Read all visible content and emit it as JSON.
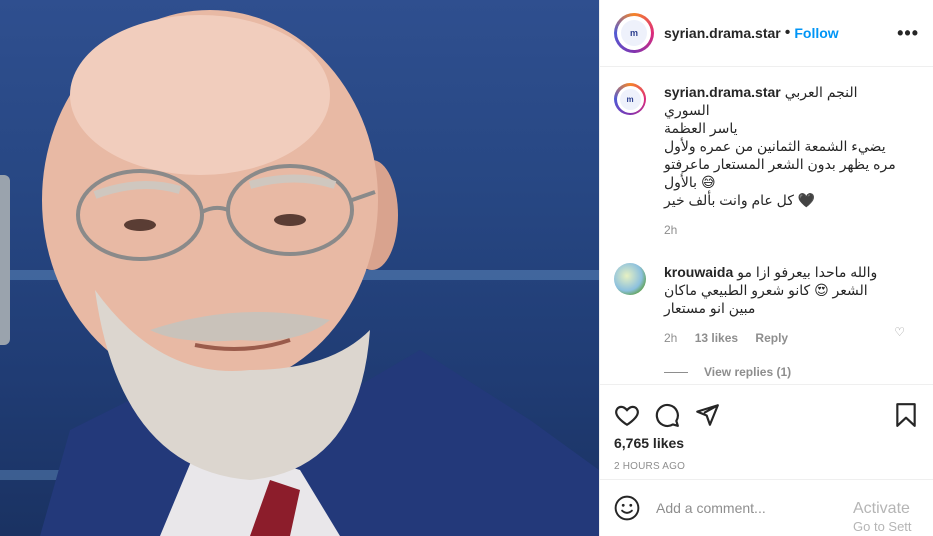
{
  "post": {
    "username": "syrian.drama.star",
    "follow_label": "Follow",
    "more_label": "•••",
    "avatar_logo_text": "m"
  },
  "caption": {
    "username": "syrian.drama.star",
    "lines": [
      "النجم العربي السوري",
      "ياسر العظمة",
      "يضيء الشمعة الثمانين من عمره ولأول",
      "مره يظهر بدون الشعر المستعار ماعرفتو",
      "😅 بالأول",
      "🖤 كل عام وانت بألف خير"
    ],
    "time": "2h"
  },
  "comment": {
    "username": "krouwaida",
    "lines": [
      "والله ماحدا بيعرفو ازا مو",
      "الشعر 😍 كانو شعرو الطبيعي ماكان",
      "مبين انو مستعار"
    ],
    "time": "2h",
    "likes": "13 likes",
    "reply_label": "Reply",
    "view_replies": "View replies (1)"
  },
  "actions": {
    "likes_text": "6,765 likes",
    "time_ago": "2 HOURS AGO"
  },
  "add_comment": {
    "placeholder": "Add a comment..."
  },
  "watermark": {
    "line1": "Activate",
    "line2": "Go to Sett"
  },
  "colors": {
    "accent": "#0095f6",
    "muted": "#8e8e8e",
    "photo_bg": "#274783"
  }
}
